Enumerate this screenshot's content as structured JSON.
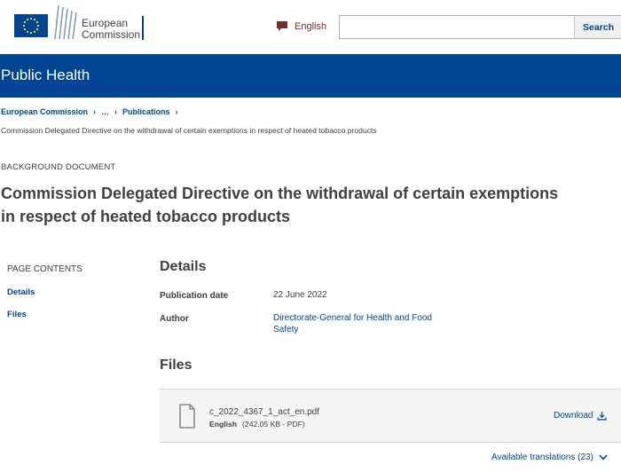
{
  "header": {
    "logo_line1": "European",
    "logo_line2": "Commission",
    "language_label": "English",
    "search_placeholder": "",
    "search_button": "Search"
  },
  "banner": {
    "title": "Public Health"
  },
  "breadcrumb": {
    "items": [
      "European Commission",
      "…",
      "Publications"
    ],
    "current": "Commission Delegated Directive on the withdrawal of certain exemptions in respect of heated tobacco products"
  },
  "page": {
    "doc_type": "BACKGROUND DOCUMENT",
    "title": "Commission Delegated Directive on the withdrawal of certain exemptions in respect of heated tobacco products"
  },
  "toc": {
    "title": "PAGE CONTENTS",
    "items": [
      "Details",
      "Files"
    ]
  },
  "details": {
    "heading": "Details",
    "publication_date_label": "Publication date",
    "publication_date": "22 June 2022",
    "author_label": "Author",
    "author": "Directorate-General for Health and Food Safety"
  },
  "files": {
    "heading": "Files",
    "file_name": "c_2022_4367_1_act_en.pdf",
    "file_language": "English",
    "file_info": "(242.05 KB - PDF)",
    "download_label": "Download",
    "translations_label": "Available translations (23)"
  },
  "colors": {
    "primary_blue": "#004494",
    "text": "#404040",
    "lang_accent": "#7a2b2b"
  }
}
